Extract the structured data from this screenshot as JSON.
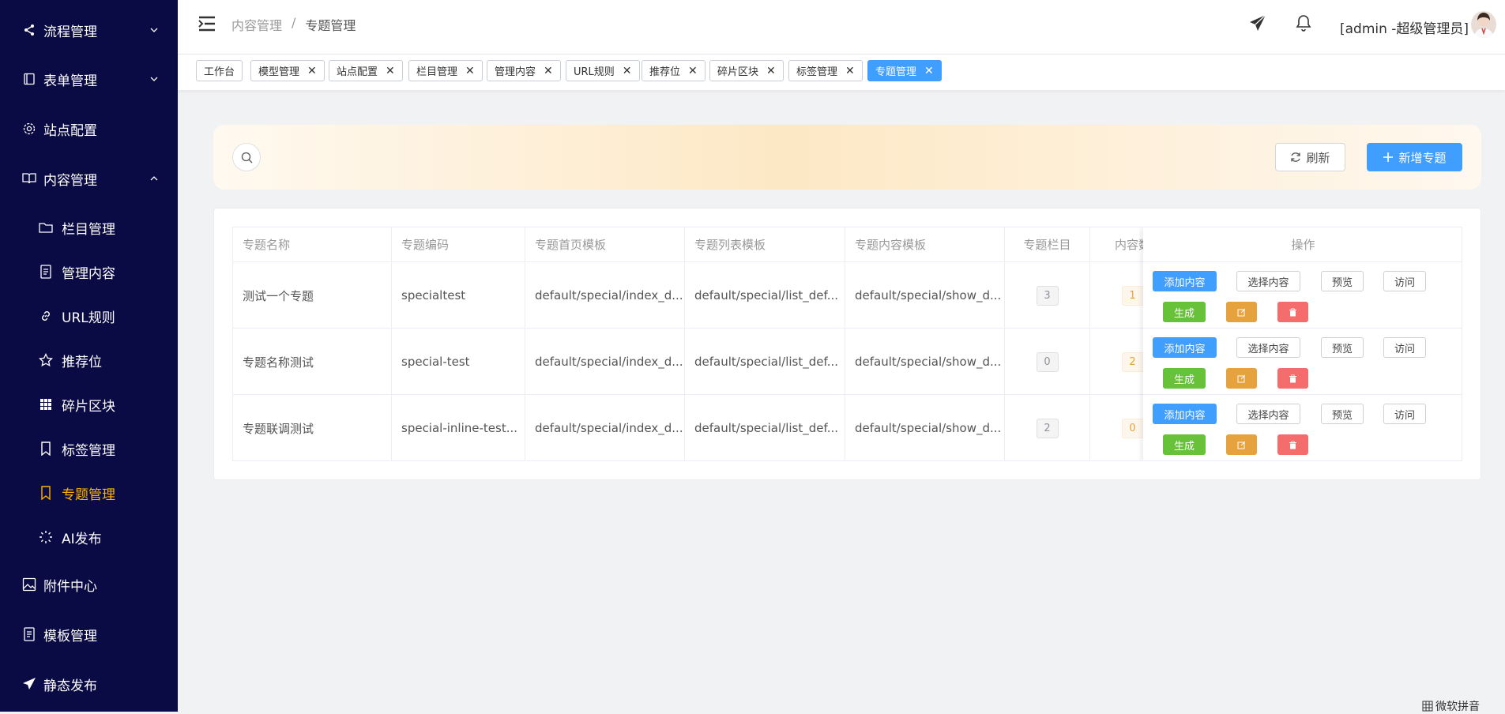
{
  "sidebar": {
    "items": [
      {
        "label": "流程管理",
        "icon": "share-icon",
        "has_chevron": "down"
      },
      {
        "label": "表单管理",
        "icon": "form-icon",
        "has_chevron": "down"
      },
      {
        "label": "站点配置",
        "icon": "gear-icon"
      },
      {
        "label": "内容管理",
        "icon": "book-icon",
        "has_chevron": "up"
      },
      {
        "label": "栏目管理",
        "icon": "folder-icon"
      },
      {
        "label": "管理内容",
        "icon": "document-icon"
      },
      {
        "label": "URL规则",
        "icon": "link-icon"
      },
      {
        "label": "推荐位",
        "icon": "star-icon"
      },
      {
        "label": "碎片区块",
        "icon": "grid-icon"
      },
      {
        "label": "标签管理",
        "icon": "bookmark-icon"
      },
      {
        "label": "专题管理",
        "icon": "bookmark-icon",
        "active": true
      },
      {
        "label": "AI发布",
        "icon": "loading-icon"
      },
      {
        "label": "附件中心",
        "icon": "picture-icon"
      },
      {
        "label": "模板管理",
        "icon": "document-icon"
      },
      {
        "label": "静态发布",
        "icon": "send-icon"
      }
    ]
  },
  "header": {
    "breadcrumb": [
      "内容管理",
      "专题管理"
    ],
    "separator": "/",
    "user": "[admin -超级管理员]"
  },
  "tabs": [
    {
      "label": "工作台",
      "closable": false
    },
    {
      "label": "模型管理",
      "closable": true
    },
    {
      "label": "站点配置",
      "closable": true
    },
    {
      "label": "栏目管理",
      "closable": true
    },
    {
      "label": "管理内容",
      "closable": true
    },
    {
      "label": "URL规则",
      "closable": true
    },
    {
      "label": "推荐位",
      "closable": true
    },
    {
      "label": "碎片区块",
      "closable": true
    },
    {
      "label": "标签管理",
      "closable": true
    },
    {
      "label": "专题管理",
      "closable": true,
      "active": true
    }
  ],
  "close_glyph": "✕",
  "toolbar": {
    "refresh_label": "刷新",
    "add_label": "新增专题"
  },
  "table": {
    "columns": [
      "专题名称",
      "专题编码",
      "专题首页模板",
      "专题列表模板",
      "专题内容模板",
      "专题栏目",
      "内容数"
    ],
    "op_header": "操作",
    "rows": [
      {
        "name": "测试一个专题",
        "code": "specialtest",
        "index_tpl": "default/special/index_d...",
        "list_tpl": "default/special/list_def...",
        "show_tpl": "default/special/show_d...",
        "columns_count": "3",
        "content_count": "1"
      },
      {
        "name": "专题名称测试",
        "code": "special-test",
        "index_tpl": "default/special/index_d...",
        "list_tpl": "default/special/list_def...",
        "show_tpl": "default/special/show_d...",
        "columns_count": "0",
        "content_count": "2"
      },
      {
        "name": "专题联调测试",
        "code": "special-inline-test...",
        "index_tpl": "default/special/index_d...",
        "list_tpl": "default/special/list_def...",
        "show_tpl": "default/special/show_d...",
        "columns_count": "2",
        "content_count": "0"
      }
    ],
    "row_actions": {
      "add_content": "添加内容",
      "select_content": "选择内容",
      "preview": "预览",
      "visit": "访问",
      "generate": "生成"
    }
  },
  "ime": {
    "label": "微软拼音"
  },
  "colors": {
    "sidebar_bg": "#0a0a44",
    "active": "#ffb400",
    "primary": "#409eff",
    "success": "#67c23a",
    "warning": "#e6a23c",
    "danger": "#f56c6c"
  }
}
